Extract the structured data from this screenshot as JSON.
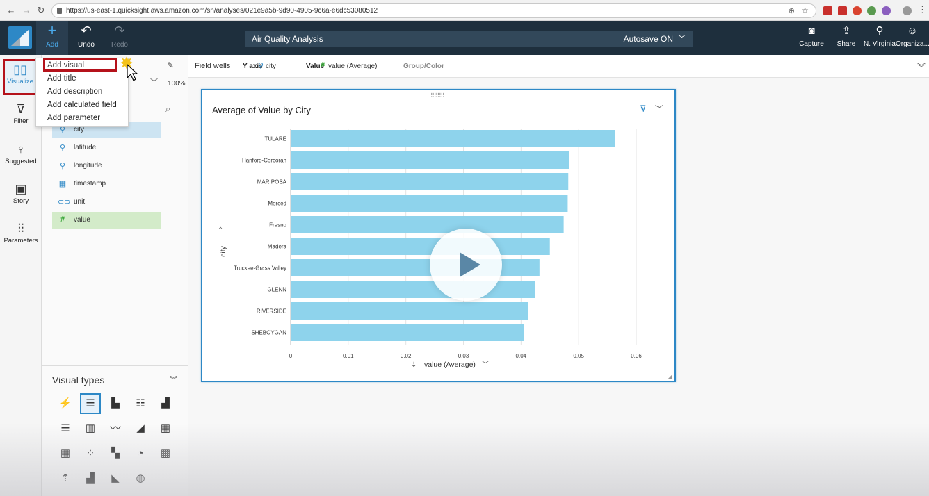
{
  "browser": {
    "url": "https://us-east-1.quicksight.aws.amazon.com/sn/analyses/021e9a5b-9d90-4905-9c6a-e6dc53080512"
  },
  "header": {
    "add_label": "Add",
    "undo_label": "Undo",
    "redo_label": "Redo",
    "analysis_title": "Air Quality Analysis",
    "autosave_label": "Autosave ON",
    "capture_label": "Capture",
    "share_label": "Share",
    "region_label": "N. Virginia",
    "account_label": "Organiza..."
  },
  "rail": {
    "visualize": "Visualize",
    "filter": "Filter",
    "suggested": "Suggested",
    "story": "Story",
    "parameters": "Parameters"
  },
  "add_menu": {
    "items": [
      "Add visual",
      "Add title",
      "Add description",
      "Add calculated field",
      "Add parameter"
    ]
  },
  "field_panel": {
    "zoom": "100%",
    "fields": [
      {
        "name": "city",
        "kind": "dimension",
        "icon": "location-icon"
      },
      {
        "name": "latitude",
        "kind": "dimension",
        "icon": "location-icon"
      },
      {
        "name": "longitude",
        "kind": "dimension",
        "icon": "location-icon"
      },
      {
        "name": "timestamp",
        "kind": "dimension",
        "icon": "calendar-icon"
      },
      {
        "name": "unit",
        "kind": "dimension",
        "icon": "tag-icon"
      },
      {
        "name": "value",
        "kind": "measure",
        "icon": "hash-icon"
      }
    ]
  },
  "visual_types": {
    "title": "Visual types"
  },
  "field_wells": {
    "label": "Field wells",
    "y_axis_label": "Y axis",
    "y_axis_value": "city",
    "value_label": "Value",
    "value_value": "value (Average)",
    "group_label": "Group/Color"
  },
  "visual": {
    "title": "Average of Value by City"
  },
  "colors": {
    "bar": "#8ed3ec",
    "accent": "#2d88c6",
    "header_bg": "#1e2f3d",
    "highlight_red": "#b5121b"
  },
  "chart_data": {
    "type": "bar",
    "orientation": "horizontal",
    "title": "Average of Value by City",
    "xlabel": "value (Average)",
    "ylabel": "city",
    "categories": [
      "TULARE",
      "Hanford-Corcoran",
      "MARIPOSA",
      "Merced",
      "Fresno",
      "Madera",
      "Truckee-Grass Valley",
      "GLENN",
      "RIVERSIDE",
      "SHEBOYGAN"
    ],
    "values": [
      0.0563,
      0.0483,
      0.0482,
      0.0481,
      0.0474,
      0.045,
      0.0432,
      0.0424,
      0.0412,
      0.0405
    ],
    "xlim": [
      0,
      0.06
    ],
    "xticks": [
      "0",
      "0.01",
      "0.02",
      "0.03",
      "0.04",
      "0.05",
      "0.06"
    ],
    "xtick_values": [
      0,
      0.01,
      0.02,
      0.03,
      0.04,
      0.05,
      0.06
    ],
    "grid": true
  }
}
